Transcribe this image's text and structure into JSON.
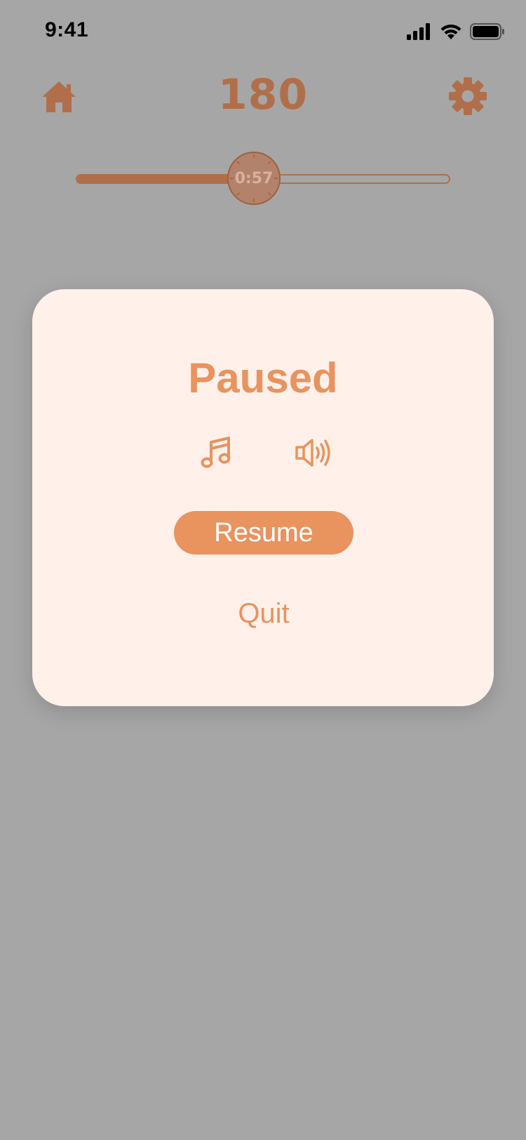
{
  "status_bar": {
    "time": "9:41"
  },
  "top_bar": {
    "score": "180"
  },
  "timer": {
    "label": "0:57",
    "progress_fraction": 0.45
  },
  "pause_modal": {
    "title": "Paused",
    "resume_label": "Resume",
    "quit_label": "Quit"
  },
  "icons": [
    "home-icon",
    "gear-icon",
    "music-note-icon",
    "speaker-icon",
    "cellular-signal-icon",
    "wifi-icon",
    "battery-icon"
  ],
  "colors": {
    "accent_dark": "#b06f4a",
    "accent": "#e9935f",
    "modal_bg": "#fff1ea",
    "overlay": "#a6a6a6",
    "tile": "#7fa39d"
  }
}
